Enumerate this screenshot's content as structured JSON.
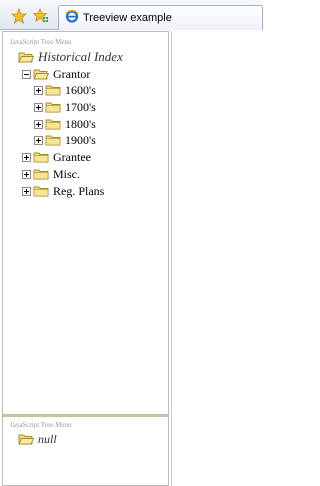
{
  "toolbar": {
    "favorites_icon": "star-icon",
    "add_favorite_icon": "add-favorite-icon",
    "tab_title": "Treeview example",
    "tab_icon": "ie-page-icon"
  },
  "top_pane": {
    "caption": "JavaScript Tree Menu",
    "root": "Historical Index",
    "nodes": [
      {
        "label": "Grantor",
        "expander": "minus"
      },
      {
        "label": "1600's",
        "expander": "plus"
      },
      {
        "label": "1700's",
        "expander": "plus"
      },
      {
        "label": "1800's",
        "expander": "plus"
      },
      {
        "label": "1900's",
        "expander": "plus"
      },
      {
        "label": "Grantee",
        "expander": "plus"
      },
      {
        "label": "Misc.",
        "expander": "plus"
      },
      {
        "label": "Reg. Plans",
        "expander": "plus"
      }
    ]
  },
  "bottom_pane": {
    "caption": "JavaScript Tree Menu",
    "root": "null"
  },
  "colors": {
    "folder_fill": "#f2dc84",
    "folder_stroke": "#a88a2c",
    "splitter": "#cbbfa6"
  }
}
